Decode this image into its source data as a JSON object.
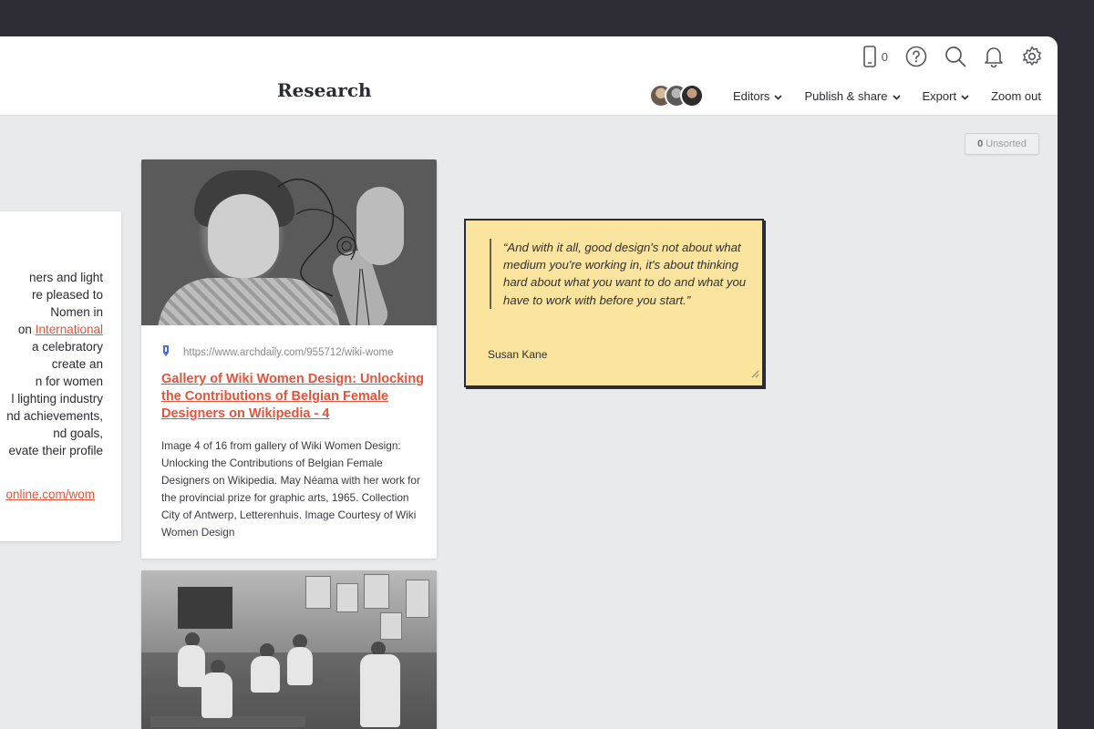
{
  "board": {
    "title": "Research"
  },
  "toolbar": {
    "device_count": "0",
    "icons": [
      "mobile-device-icon",
      "help-icon",
      "search-icon",
      "bell-icon",
      "gear-icon"
    ],
    "menu": {
      "editors": "Editors",
      "publish": "Publish & share",
      "export": "Export",
      "zoom": "Zoom out"
    }
  },
  "unsorted": {
    "count": "0",
    "label": "Unsorted"
  },
  "text_card": {
    "lines": [
      "ners and light",
      "re pleased to",
      "Nomen in",
      "on ",
      "a celebratory",
      "create an",
      "n for women",
      "l lighting industry",
      "nd achievements,",
      "nd goals,",
      "evate their profile"
    ],
    "link_text": "International ",
    "url_fragment": "online.com/wom"
  },
  "link_card": {
    "url": "https://www.archdaily.com/955712/wiki-wome",
    "title": "Gallery of Wiki Women Design: Unlocking the Contributions of Belgian Female Designers on Wikipedia - 4",
    "description": "Image 4 of 16 from gallery of Wiki Women Design: Unlocking the Contributions of Belgian Female Designers on Wikipedia. May Néama with her work for the provincial prize for graphic arts, 1965. Collection City of Antwerp, Letterenhuis. Image Courtesy of Wiki Women Design"
  },
  "note": {
    "quote": "“And with it all, good design's not about what medium you're working in, it's about thinking hard about what you want to do and what you have to work with before you start.”",
    "author": "Susan Kane"
  },
  "colors": {
    "accent": "#e7533a",
    "note_bg": "#fbe49d",
    "canvas": "#e9eaec",
    "frame": "#2d2c35"
  }
}
